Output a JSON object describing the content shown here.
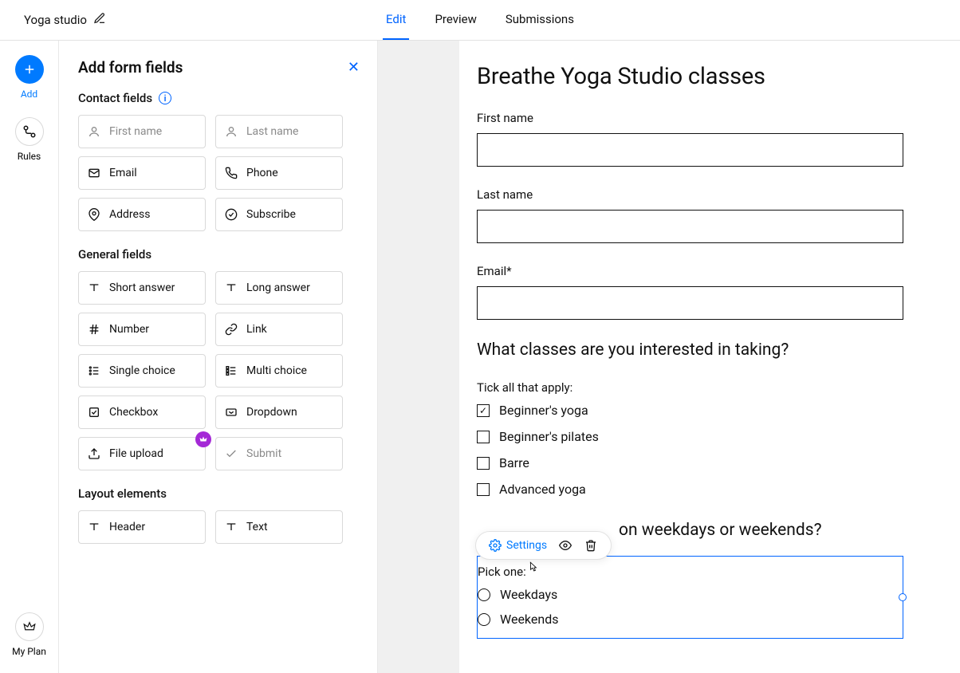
{
  "header": {
    "title": "Yoga studio",
    "tabs": {
      "edit": "Edit",
      "preview": "Preview",
      "submissions": "Submissions"
    }
  },
  "rail": {
    "add": "Add",
    "rules": "Rules",
    "myplan": "My Plan"
  },
  "panel": {
    "title": "Add form fields",
    "contact_label": "Contact fields",
    "general_label": "General fields",
    "layout_label": "Layout elements",
    "contact": {
      "first_name": "First name",
      "last_name": "Last name",
      "email": "Email",
      "phone": "Phone",
      "address": "Address",
      "subscribe": "Subscribe"
    },
    "general": {
      "short_answer": "Short answer",
      "long_answer": "Long answer",
      "number": "Number",
      "link": "Link",
      "single_choice": "Single choice",
      "multi_choice": "Multi choice",
      "checkbox": "Checkbox",
      "dropdown": "Dropdown",
      "file_upload": "File upload",
      "submit": "Submit"
    },
    "layout": {
      "header": "Header",
      "text": "Text"
    }
  },
  "form": {
    "title": "Breathe Yoga Studio classes",
    "fields": {
      "first_name": "First name",
      "last_name": "Last name",
      "email": "Email*"
    },
    "q1": {
      "heading": "What classes are you interested in taking?",
      "caption": "Tick all that apply:",
      "opts": {
        "o1": "Beginner's yoga",
        "o2": "Beginner's pilates",
        "o3": "Barre",
        "o4": "Advanced yoga"
      }
    },
    "q2": {
      "tail": "on weekdays or weekends?",
      "caption": "Pick one:",
      "opts": {
        "o1": "Weekdays",
        "o2": "Weekends"
      }
    }
  },
  "tools": {
    "settings": "Settings"
  }
}
